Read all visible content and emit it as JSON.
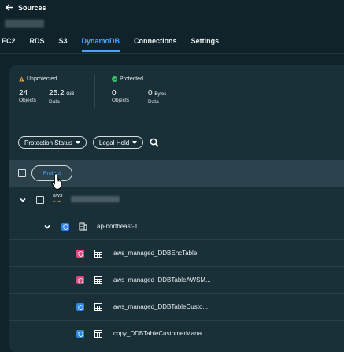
{
  "header": {
    "back_label": "Sources"
  },
  "tabs": [
    {
      "label": "EC2"
    },
    {
      "label": "RDS"
    },
    {
      "label": "S3"
    },
    {
      "label": "DynamoDB",
      "active": true
    },
    {
      "label": "Connections"
    },
    {
      "label": "Settings"
    }
  ],
  "stats": {
    "unprotected": {
      "title": "Unprotected",
      "objects_value": "24",
      "objects_label": "Objects",
      "data_value": "25.2",
      "data_unit": "GiB",
      "data_label": "Data",
      "icon": "warning-icon",
      "color": "#e8a33d"
    },
    "protected": {
      "title": "Protected",
      "objects_value": "0",
      "objects_label": "Objects",
      "data_value": "0",
      "data_unit": "Bytes",
      "data_label": "Data",
      "icon": "check-circle-icon",
      "color": "#3ec46d"
    }
  },
  "filters": {
    "protection_status": "Protection Status",
    "legal_hold": "Legal Hold"
  },
  "table": {
    "protect_button": "Protect",
    "cloud_label": "aws",
    "region": "ap-northeast-1",
    "items": [
      {
        "name": "aws_managed_DDBEncTable",
        "status": "unprotected"
      },
      {
        "name": "aws_managed_DDBTableAWSM...",
        "status": "unprotected"
      },
      {
        "name": "aws_managed_DDBTableCusto...",
        "status": "protected"
      },
      {
        "name": "copy_DDBTableCustomerMana...",
        "status": "protected"
      }
    ]
  },
  "colors": {
    "accent": "#4da3ff",
    "protected_shield": "#2f86e0",
    "unprotected_shield": "#e0467c"
  }
}
